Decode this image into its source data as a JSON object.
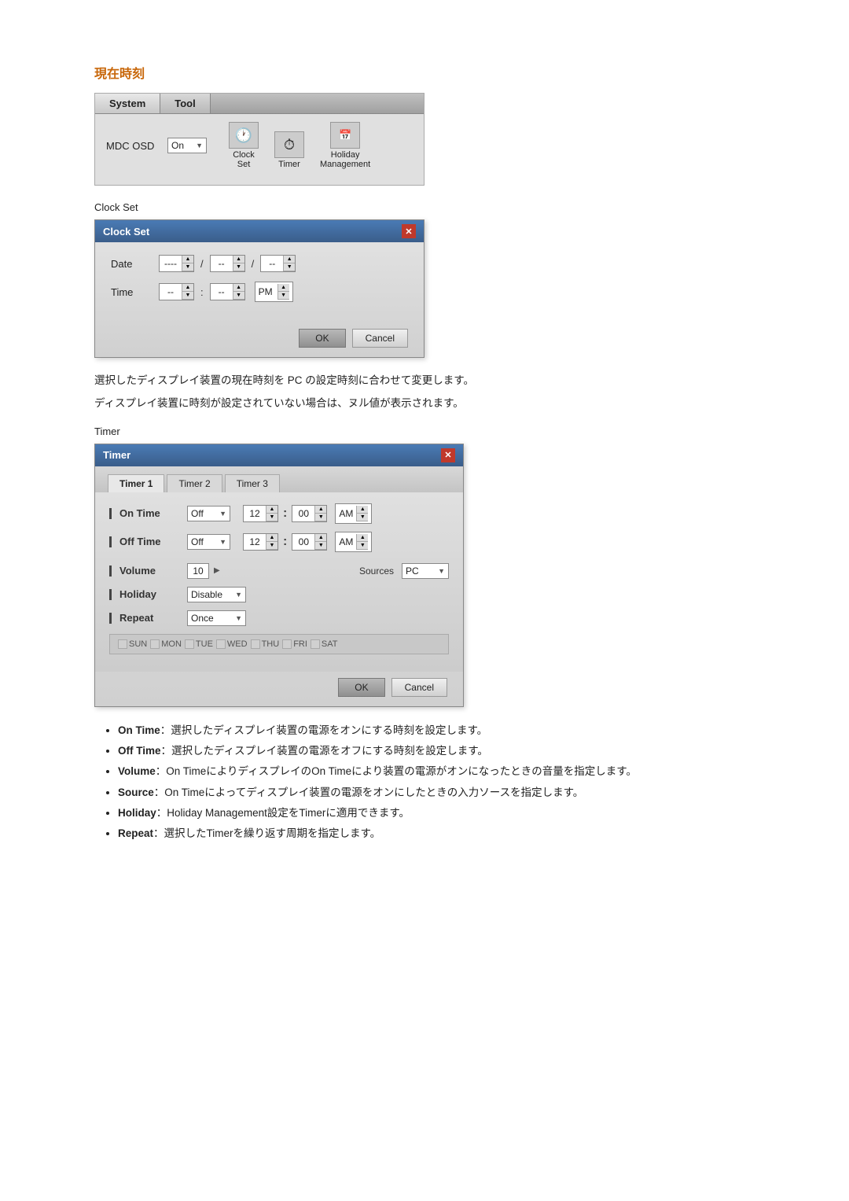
{
  "page": {
    "section_title": "現在時刻",
    "mdc_tabs": [
      "System",
      "Tool"
    ],
    "mdc_active_tab": "System",
    "mdc_osd_label": "MDC OSD",
    "mdc_osd_value": "On",
    "mdc_icons": [
      {
        "name": "Clock Set",
        "icon": "🕐"
      },
      {
        "name": "Timer",
        "icon": "⏱"
      },
      {
        "name": "Holiday\nManagement",
        "icon": "📅"
      }
    ],
    "clock_set_label": "Clock Set",
    "clock_dialog": {
      "title": "Clock Set",
      "date_label": "Date",
      "date_fields": [
        "----",
        "/",
        "--",
        "/",
        "--"
      ],
      "time_label": "Time",
      "time_fields": [
        "--",
        ":",
        "--"
      ],
      "time_ampm": "PM",
      "ok_label": "OK",
      "cancel_label": "Cancel"
    },
    "desc1": "選択したディスプレイ装置の現在時刻を PC の設定時刻に合わせて変更します。",
    "desc2": "ディスプレイ装置に時刻が設定されていない場合は、ヌル値が表示されます。",
    "timer_label": "Timer",
    "timer_dialog": {
      "title": "Timer",
      "tabs": [
        "Timer 1",
        "Timer 2",
        "Timer 3"
      ],
      "active_tab": "Timer 1",
      "on_time_label": "On Time",
      "on_time_value": "Off",
      "on_time_hour": "12",
      "on_time_min": "00",
      "on_time_ampm": "AM",
      "off_time_label": "Off Time",
      "off_time_value": "Off",
      "off_time_hour": "12",
      "off_time_min": "00",
      "off_time_ampm": "AM",
      "volume_label": "Volume",
      "volume_value": "10",
      "sources_label": "Sources",
      "sources_value": "PC",
      "holiday_label": "Holiday",
      "holiday_value": "Disable",
      "repeat_label": "Repeat",
      "repeat_value": "Once",
      "days": [
        "SUN",
        "MON",
        "TUE",
        "WED",
        "THU",
        "FRI",
        "SAT"
      ],
      "ok_label": "OK",
      "cancel_label": "Cancel"
    },
    "bullets": [
      {
        "key": "On Time",
        "sep": "：",
        "text": "選択したディスプレイ装置の電源をオンにする時刻を設定します。"
      },
      {
        "key": "Off Time",
        "sep": "：",
        "text": "選択したディスプレイ装置の電源をオフにする時刻を設定します。"
      },
      {
        "key": "Volume",
        "sep": "：",
        "text": "On TimeによりディスプレイのOn Timeにより装置の電源がオンになったときの音量を指定します。"
      },
      {
        "key": "Source",
        "sep": "：",
        "text": "On Timeによってディスプレイ装置の電源をオンにしたときの入力ソースを指定します。"
      },
      {
        "key": "Holiday",
        "sep": "：",
        "text": "Holiday Management設定をTimerに適用できます。"
      },
      {
        "key": "Repeat",
        "sep": "：",
        "text": "選択したTimerを繰り返す周期を指定します。"
      }
    ]
  }
}
